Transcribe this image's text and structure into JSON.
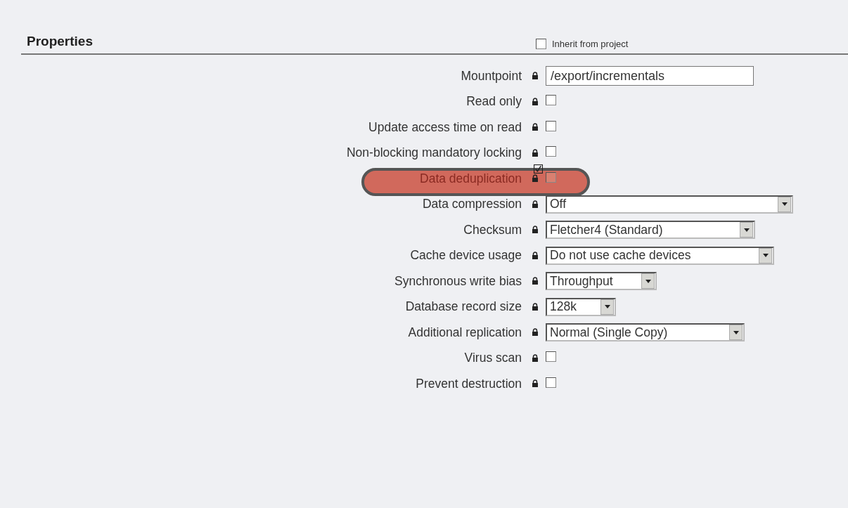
{
  "header": {
    "title": "Properties",
    "inherit": {
      "label": "Inherit from project",
      "checked": false
    }
  },
  "rows": [
    {
      "kind": "text",
      "label": "Mountpoint",
      "locked": true,
      "value": "/export/incrementals",
      "highlighted": false
    },
    {
      "kind": "checkbox",
      "label": "Read only",
      "locked": true,
      "checked": false,
      "highlighted": false
    },
    {
      "kind": "checkbox",
      "label": "Update access time on read",
      "locked": true,
      "checked": false,
      "highlighted": false
    },
    {
      "kind": "checkbox",
      "label": "Non-blocking mandatory locking",
      "locked": true,
      "checked": false,
      "highlighted": false
    },
    {
      "kind": "checkbox",
      "label": "Data deduplication",
      "locked": true,
      "checked": false,
      "highlighted": true
    },
    {
      "kind": "select",
      "label": "Data compression",
      "locked": true,
      "value": "Off",
      "highlighted": false
    },
    {
      "kind": "select",
      "label": "Checksum",
      "locked": true,
      "value": "Fletcher4 (Standard)",
      "highlighted": false
    },
    {
      "kind": "select",
      "label": "Cache device usage",
      "locked": true,
      "value": "Do not use cache devices",
      "highlighted": false
    },
    {
      "kind": "select",
      "label": "Synchronous write bias",
      "locked": true,
      "value": "Throughput",
      "highlighted": false
    },
    {
      "kind": "select",
      "label": "Database record size",
      "locked": true,
      "value": "128k",
      "highlighted": false
    },
    {
      "kind": "select",
      "label": "Additional replication",
      "locked": true,
      "value": "Normal (Single Copy)",
      "highlighted": false
    },
    {
      "kind": "checkbox",
      "label": "Virus scan",
      "locked": true,
      "checked": false,
      "highlighted": false
    },
    {
      "kind": "checkbox",
      "label": "Prevent destruction",
      "locked": true,
      "checked": false,
      "highlighted": false
    }
  ]
}
